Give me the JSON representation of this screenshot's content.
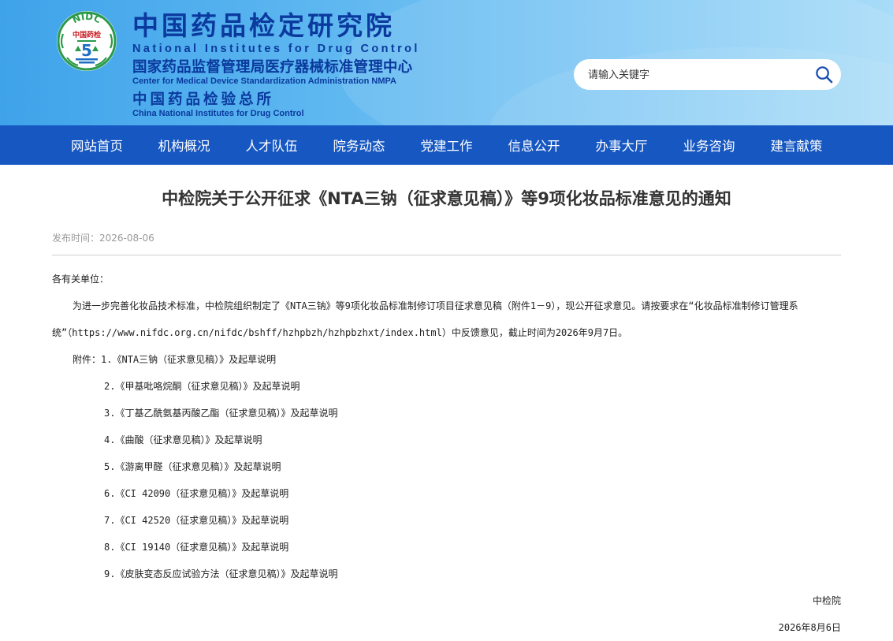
{
  "header": {
    "logo": {
      "text_top": "NIDC",
      "text_mid": "中国药检",
      "icon": "nidc-emblem"
    },
    "title_cn": "中国药品检定研究院",
    "title_en": "National Institutes for Drug Control",
    "subtitle1_cn": "国家药品监督管理局医疗器械标准管理中心",
    "subtitle1_en": "Center for Medical Device Standardization Administration NMPA",
    "subtitle2_cn": "中国药品检验总所",
    "subtitle2_en": "China National Institutes for Drug Control",
    "search": {
      "placeholder": "请输入关键字",
      "icon": "search-icon"
    },
    "colors": {
      "header_blue": "#3fa3ea",
      "title_navy": "#0b3a9e",
      "nav_blue": "#1657c2"
    }
  },
  "nav": {
    "items": [
      {
        "label": "网站首页"
      },
      {
        "label": "机构概况"
      },
      {
        "label": "人才队伍"
      },
      {
        "label": "院务动态"
      },
      {
        "label": "党建工作"
      },
      {
        "label": "信息公开"
      },
      {
        "label": "办事大厅"
      },
      {
        "label": "业务咨询"
      },
      {
        "label": "建言献策"
      }
    ]
  },
  "article": {
    "title": "中检院关于公开征求《NTA三钠（征求意见稿）》等9项化妆品标准意见的通知",
    "publish_label": "发布时间：",
    "publish_date": "2026-08-06",
    "salutation": "各有关单位：",
    "paragraph": "为进一步完善化妆品技术标准，中检院组织制定了《NTA三钠》等9项化妆品标准制修订项目征求意见稿（附件1－9），现公开征求意见。请按要求在“化妆品标准制修订管理系统”（https://www.nifdc.org.cn/nifdc/bshff/hzhpbzh/hzhpbzhxt/index.html）中反馈意见，截止时间为2026年9月7日。",
    "attachments_label": "附件：",
    "attachments": [
      "1.《NTA三钠（征求意见稿）》及起草说明",
      "2.《甲基吡咯烷酮（征求意见稿）》及起草说明",
      "3.《丁基乙酰氨基丙酸乙酯（征求意见稿）》及起草说明",
      "4.《曲酸（征求意见稿）》及起草说明",
      "5.《游离甲醛（征求意见稿）》及起草说明",
      "6.《CI 42090（征求意见稿）》及起草说明",
      "7.《CI 42520（征求意见稿）》及起草说明",
      "8.《CI 19140（征求意见稿）》及起草说明",
      "9.《皮肤变态反应试验方法（征求意见稿）》及起草说明"
    ],
    "signature": "中检院",
    "sign_date": "2026年8月6日"
  }
}
